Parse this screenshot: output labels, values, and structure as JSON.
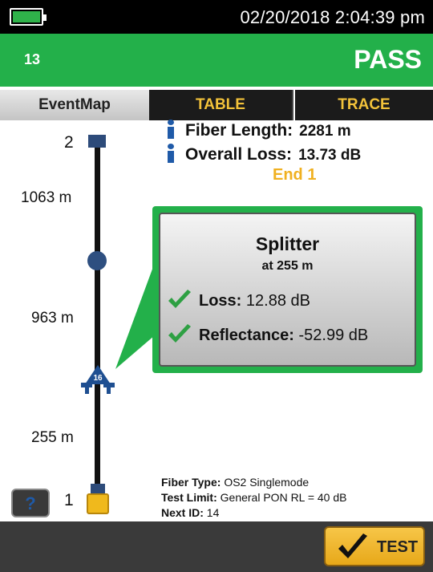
{
  "status_bar": {
    "datetime": "02/20/2018 2:04:39 pm"
  },
  "header": {
    "record_id": "13",
    "result": "PASS",
    "color": "#23b04a"
  },
  "tabs": [
    {
      "label": "EventMap",
      "active": true
    },
    {
      "label": "TABLE",
      "active": false
    },
    {
      "label": "TRACE",
      "active": false
    }
  ],
  "summary": {
    "fiber_length_label": "Fiber Length:",
    "fiber_length_value": "2281 m",
    "overall_loss_label": "Overall Loss:",
    "overall_loss_value": "13.73 dB",
    "end_label": "End 1"
  },
  "event_map": {
    "events": [
      {
        "number": "2"
      },
      {
        "number": "1"
      }
    ],
    "distances": [
      "1063 m",
      "963 m",
      "255 m"
    ],
    "splitter_label": "16"
  },
  "callout": {
    "title": "Splitter",
    "subtitle": "at 255 m",
    "loss_label": "Loss:",
    "loss_value": "12.88 dB",
    "reflectance_label": "Reflectance:",
    "reflectance_value": "-52.99 dB"
  },
  "fiber_info": {
    "fiber_type_label": "Fiber Type:",
    "fiber_type_value": "OS2 Singlemode",
    "test_limit_label": "Test Limit:",
    "test_limit_value": "General PON RL = 40 dB",
    "next_id_label": "Next ID:",
    "next_id_value": "14"
  },
  "buttons": {
    "help": "?",
    "test": "TEST"
  }
}
